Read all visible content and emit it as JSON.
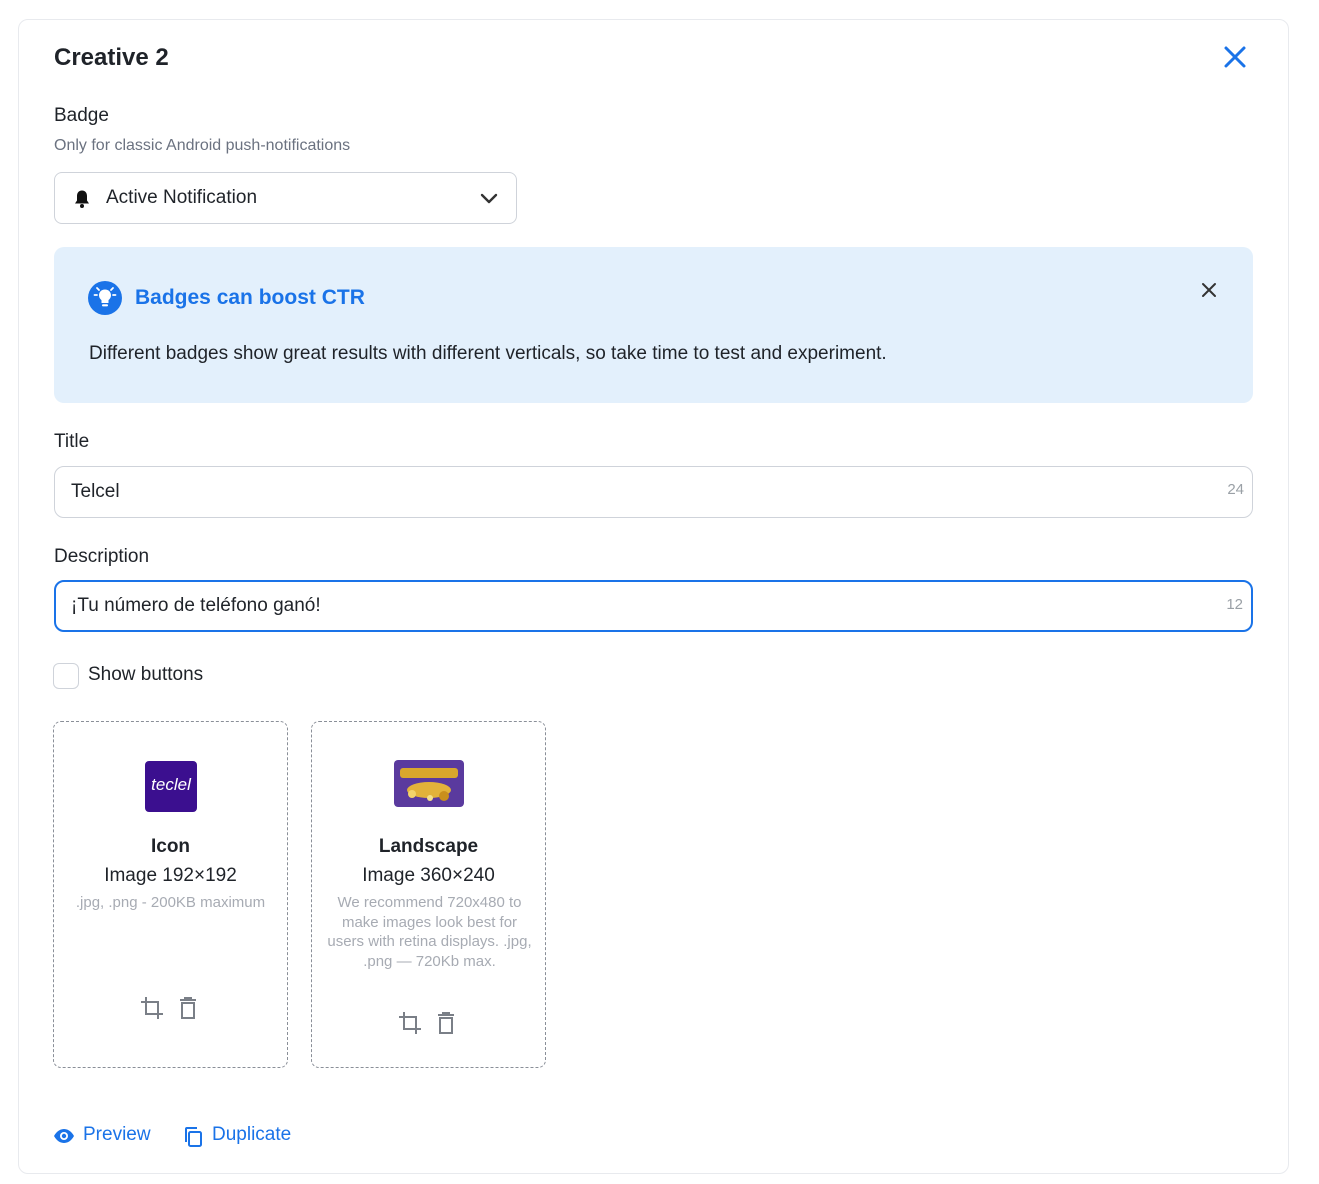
{
  "card": {
    "title": "Creative 2"
  },
  "badge": {
    "label": "Badge",
    "hint": "Only for classic Android push-notifications",
    "selected": "Active Notification"
  },
  "info": {
    "title": "Badges can boost CTR",
    "text": "Different badges show great results with different verticals, so take time to test and experiment."
  },
  "title_field": {
    "label": "Title",
    "value": "Telcel",
    "counter": "24"
  },
  "description_field": {
    "label": "Description",
    "value": "¡Tu número de teléfono ganó!",
    "counter": "12"
  },
  "show_buttons": {
    "label": "Show buttons",
    "checked": false
  },
  "uploads": [
    {
      "title": "Icon",
      "size": "Image 192×192",
      "hint": ".jpg, .png - 200KB maximum",
      "thumb_text": "teclel"
    },
    {
      "title": "Landscape",
      "size": "Image 360×240",
      "hint": "We recommend 720x480 to make images look best for users with retina displays. .jpg, .png — 720Kb max."
    }
  ],
  "actions": {
    "preview": "Preview",
    "duplicate": "Duplicate"
  },
  "colors": {
    "accent": "#1a73e8",
    "info_bg": "#e3f0fc",
    "icon_bg": "#3b0f8f",
    "landscape_bg": "#5a3a9e"
  },
  "icons": [
    "close-icon",
    "bell-icon",
    "chevron-down-icon",
    "lightbulb-icon",
    "crop-icon",
    "trash-icon",
    "eye-icon",
    "copy-icon"
  ]
}
